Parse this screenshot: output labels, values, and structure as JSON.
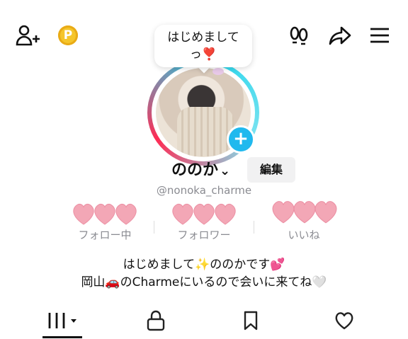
{
  "header": {
    "greeting_bubble": "はじめまして\nっ❣️",
    "coin_symbol": "P"
  },
  "profile": {
    "username": "ののか",
    "username_chevron": "⌄",
    "edit_label": "編集",
    "handle": "@nonoka_charme",
    "add_symbol": "+"
  },
  "stats": [
    {
      "label": "フォロー中",
      "value_display": "hearts"
    },
    {
      "label": "フォロワー",
      "value_display": "hearts"
    },
    {
      "label": "いいね",
      "value_display": "hearts"
    }
  ],
  "bio": {
    "line1": "はじめまして✨ののかです💕",
    "line2": "岡山🚗のCharmeにいるので会いに来てね🤍"
  },
  "tabs": [
    {
      "icon": "videos-grid-icon",
      "active": true
    },
    {
      "icon": "lock-icon",
      "active": false
    },
    {
      "icon": "bookmark-icon",
      "active": false
    },
    {
      "icon": "heart-icon",
      "active": false
    }
  ],
  "colors": {
    "accent_cyan": "#20d5ec",
    "accent_pink": "#fe2c55",
    "plus_blue": "#20b9ee",
    "coin_gold": "#f5c52a",
    "heart_pink": "#f3a7b6"
  }
}
